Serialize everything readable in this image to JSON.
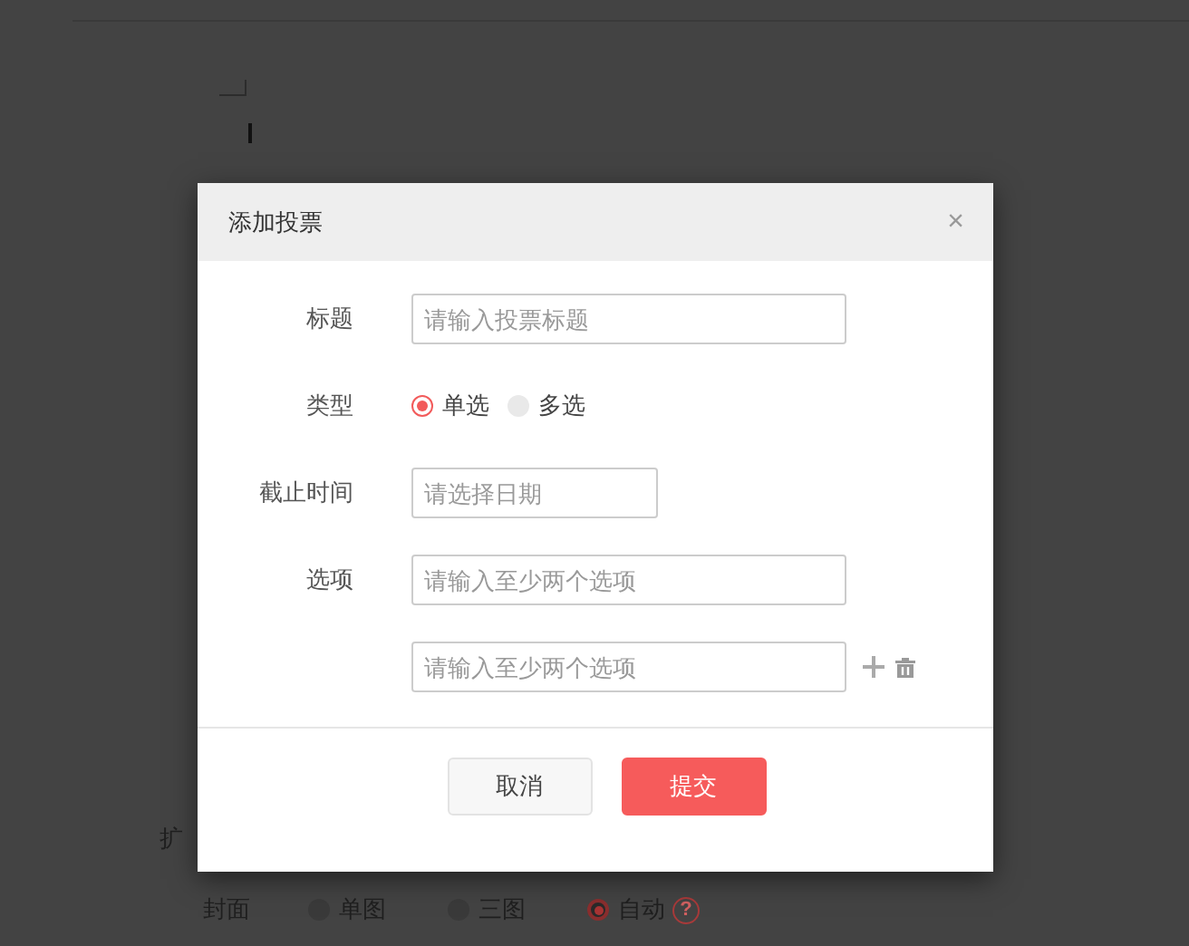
{
  "background": {
    "section_label": "扩",
    "cover": {
      "label": "封面",
      "options": [
        {
          "label": "单图",
          "selected": false
        },
        {
          "label": "三图",
          "selected": false
        },
        {
          "label": "自动",
          "selected": true
        }
      ],
      "help": "?"
    }
  },
  "dialog": {
    "title": "添加投票",
    "close": "×",
    "fields": [
      {
        "kind": "text",
        "label": "标题",
        "placeholder": "请输入投票标题"
      },
      {
        "kind": "radio",
        "label": "类型",
        "options": [
          {
            "label": "单选",
            "selected": true
          },
          {
            "label": "多选",
            "selected": false
          }
        ]
      },
      {
        "kind": "date",
        "label": "截止时间",
        "placeholder": "请选择日期"
      },
      {
        "kind": "option",
        "label": "选项",
        "placeholder": "请输入至少两个选项",
        "actions": false
      },
      {
        "kind": "option",
        "placeholder": "请输入至少两个选项",
        "actions": true
      }
    ],
    "buttons": [
      {
        "kind": "cancel",
        "label": "取消"
      },
      {
        "kind": "submit",
        "label": "提交"
      }
    ]
  }
}
